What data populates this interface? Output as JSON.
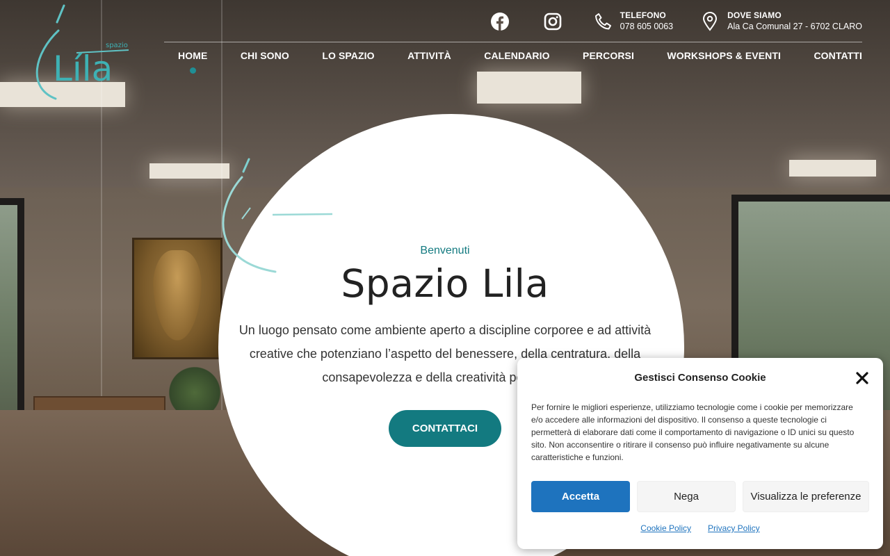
{
  "logo": {
    "text": "Líla",
    "small": "spazio"
  },
  "topbar": {
    "phone": {
      "label": "TELEFONO",
      "value": "078 605 0063"
    },
    "location": {
      "label": "DOVE SIAMO",
      "value": "Ala Ca Comunal 27 - 6702 CLARO"
    }
  },
  "nav": {
    "items": [
      {
        "label": "HOME"
      },
      {
        "label": "CHI SONO"
      },
      {
        "label": "LO SPAZIO"
      },
      {
        "label": "ATTIVITÀ"
      },
      {
        "label": "CALENDARIO"
      },
      {
        "label": "PERCORSI"
      },
      {
        "label": "WORKSHOPS & EVENTI"
      },
      {
        "label": "CONTATTI"
      }
    ]
  },
  "hero": {
    "kicker": "Benvenuti",
    "title": "Spazio Lila",
    "intro": "Un luogo pensato come ambiente aperto a discipline corporee e ad attività creative che potenziano l’aspetto del benessere, della centratura, della consapevolezza e della creatività personale.",
    "cta": "CONTATTACI"
  },
  "cookie": {
    "title": "Gestisci Consenso Cookie",
    "body": "Per fornire le migliori esperienze, utilizziamo tecnologie come i cookie per memorizzare e/o accedere alle informazioni del dispositivo. Il consenso a queste tecnologie ci permetterà di elaborare dati come il comportamento di navigazione o ID unici su questo sito. Non acconsentire o ritirare il consenso può influire negativamente su alcune caratteristiche e funzioni.",
    "accept": "Accetta",
    "deny": "Nega",
    "preferences": "Visualizza le preferenze",
    "cookie_policy": "Cookie Policy",
    "privacy_policy": "Privacy Policy"
  },
  "colors": {
    "accent": "#137a80",
    "cookie_blue": "#1e73be"
  }
}
